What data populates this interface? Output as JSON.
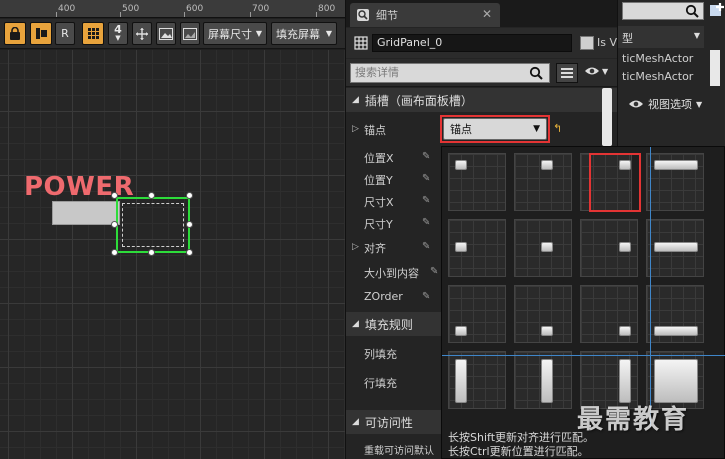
{
  "ruler": {
    "labels": [
      "400",
      "500",
      "600",
      "700",
      "800"
    ]
  },
  "toolbar": {
    "lock_label": "",
    "r_label": "R",
    "snap_value": "4",
    "screen_size_label": "屏幕尺寸",
    "fill_screen_label": "填充屏幕"
  },
  "canvas": {
    "power_text": "POWER"
  },
  "details": {
    "tab_title": "细节",
    "name_value": "GridPanel_0",
    "isv_label": "Is V",
    "search_placeholder": "搜索详情",
    "slot_section": "插槽（画布面板槽）",
    "anchor_label": "锚点",
    "anchor_value": "锚点",
    "props": {
      "pos_x": "位置X",
      "pos_y": "位置Y",
      "size_x": "尺寸X",
      "size_y": "尺寸Y",
      "align": "对齐",
      "size_to_content": "大小到内容",
      "zorder": "ZOrder"
    },
    "fill_rules": {
      "section": "填充规则",
      "column_fill": "列填充",
      "row_fill": "行填充"
    },
    "accessibility": {
      "section": "可访问性",
      "override": "重载可访问默认"
    }
  },
  "anchor_popup": {
    "hint_shift": "长按Shift更新对齐进行匹配。",
    "hint_ctrl": "长按Ctrl更新位置进行匹配。"
  },
  "right_panel": {
    "header": "型",
    "items": [
      "ticMeshActor",
      "ticMeshActor"
    ],
    "view_options": "视图选项"
  },
  "watermark": "最需教育",
  "colors": {
    "accent_orange": "#e8a33c",
    "highlight_red": "#e33434",
    "selection_green": "#2ddc3a",
    "power_text": "#ef6a6e",
    "guide_blue": "#3f86c9"
  }
}
